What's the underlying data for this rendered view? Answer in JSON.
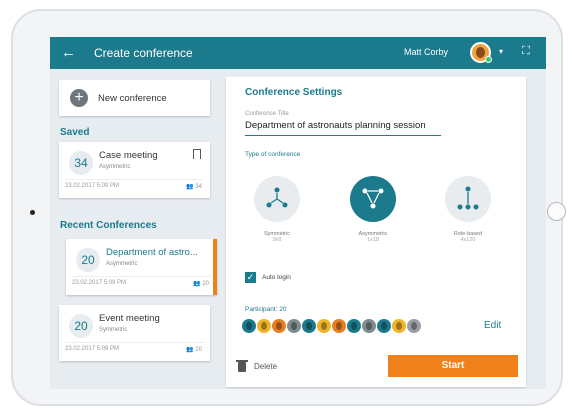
{
  "header": {
    "back_icon": "arrow-left-icon",
    "title": "Create conference",
    "user_name": "Matt Corby",
    "caret": "▾",
    "expand_icon": "expand-icon"
  },
  "sidebar": {
    "new_conference": "New conference",
    "saved_heading": "Saved",
    "saved": [
      {
        "number": "34",
        "name": "Case meeting",
        "type": "Asymmetric",
        "date": "23.02.2017 5:09 PM",
        "participants": "34"
      }
    ],
    "recent_heading": "Recent Conferences",
    "recent": [
      {
        "number": "20",
        "name": "Department of astro...",
        "type": "Asymmetric",
        "date": "23.02.2017 5:09 PM",
        "participants": "20"
      },
      {
        "number": "20",
        "name": "Event meeting",
        "type": "Symmetric",
        "date": "23.02.2017 5:09 PM",
        "participants": "20"
      }
    ]
  },
  "settings": {
    "heading": "Conference Settings",
    "title_label": "Conference Title",
    "title_value": "Department of astronauts planning session",
    "type_label": "Type of conference",
    "types": [
      {
        "name": "Symmetric",
        "sub": "9x9",
        "selected": false
      },
      {
        "name": "Asymmetric",
        "sub": "1x18",
        "selected": true
      },
      {
        "name": "Role-based",
        "sub": "4x120",
        "selected": false
      }
    ],
    "auto_login": "Auto login",
    "participants_label": "Participant: 20",
    "avatar_colors": [
      "#1b7b8c",
      "#f0b429",
      "#e67e22",
      "#7f8c8d",
      "#1b7b8c",
      "#f0b429",
      "#e67e22",
      "#1b7b8c",
      "#7f8c8d",
      "#1b7b8c",
      "#f0b429",
      "#9aa0a6"
    ],
    "edit": "Edit",
    "delete": "Delete",
    "start": "Start"
  },
  "colors": {
    "primary": "#1b7b8c",
    "accent": "#f0811a"
  }
}
